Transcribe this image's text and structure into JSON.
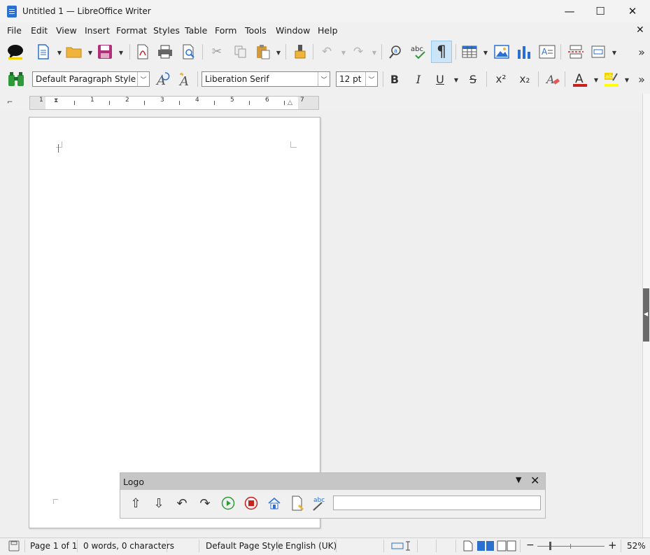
{
  "window": {
    "title": "Untitled 1 — LibreOffice Writer",
    "minimize_glyph": "—",
    "maximize_glyph": "☐",
    "close_glyph": "✕"
  },
  "menubar": {
    "items": [
      "File",
      "Edit",
      "View",
      "Insert",
      "Format",
      "Styles",
      "Table",
      "Form",
      "Tools",
      "Window",
      "Help"
    ],
    "close_doc_glyph": "✕"
  },
  "toolbar_standard": {
    "buttons": [
      "speech-bubble",
      "new-document",
      "open",
      "save",
      "export-pdf",
      "print",
      "print-preview",
      "cut",
      "copy",
      "paste",
      "clone-formatting",
      "undo",
      "redo",
      "find-replace",
      "spelling",
      "formatting-marks",
      "insert-table",
      "insert-image",
      "insert-chart",
      "insert-text-box",
      "insert-page-break",
      "insert-field",
      "more"
    ]
  },
  "toolbar_formatting": {
    "paragraph_style": "Default Paragraph Style",
    "font_name": "Liberation Serif",
    "font_size": "12 pt",
    "bold_label": "B",
    "italic_label": "I",
    "underline_label": "U",
    "strike_label": "S",
    "superscript_label": "x²",
    "subscript_label": "x₂"
  },
  "ruler": {
    "numbers": [
      "1",
      "1",
      "2",
      "3",
      "4",
      "5",
      "6",
      "7"
    ]
  },
  "logo_panel": {
    "title": "Logo",
    "command_input": ""
  },
  "statusbar": {
    "page": "Page 1 of 1",
    "words": "0 words, 0 characters",
    "page_style": "Default Page Style",
    "language": "English (UK)",
    "zoom": "52%"
  },
  "colors": {
    "accent_blue": "#2b6fd1",
    "font_color_bar": "#c9211e",
    "highlight_bar": "#ffff00",
    "active_button_bg": "#cce4f7"
  }
}
